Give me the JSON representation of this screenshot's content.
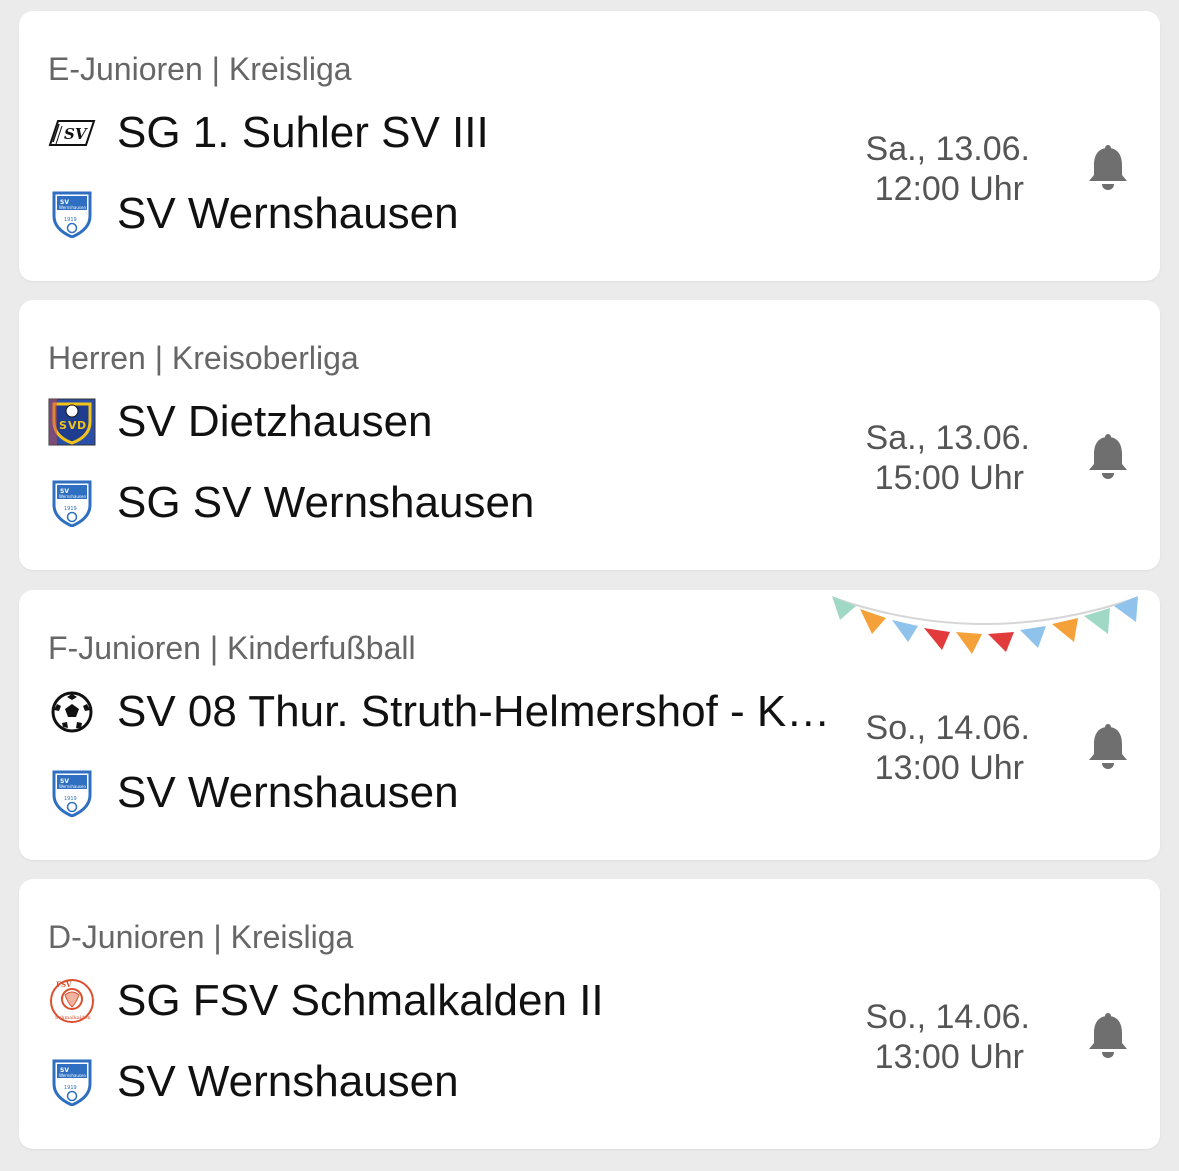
{
  "matches": [
    {
      "league": "E-Junioren | Kreisliga",
      "home": {
        "name": "SG 1. Suhler SV III",
        "crest": "suhl-sv-logo"
      },
      "away": {
        "name": "SV Wernshausen",
        "crest": "sv-wernshausen-crest"
      },
      "date": "Sa., 13.06.",
      "time": "12:00 Uhr",
      "bell_icon": "bell-icon"
    },
    {
      "league": "Herren | Kreisoberliga",
      "home": {
        "name": "SV Dietzhausen",
        "crest": "sv-dietzhausen-crest"
      },
      "away": {
        "name": "SG SV Wernshausen",
        "crest": "sv-wernshausen-crest"
      },
      "date": "Sa., 13.06.",
      "time": "15:00 Uhr",
      "bell_icon": "bell-icon"
    },
    {
      "league": "F-Junioren | Kinderfußball",
      "home": {
        "name": "SV 08 Thur. Struth-Helmershof - K…",
        "crest": "soccer-ball-icon"
      },
      "away": {
        "name": "SV Wernshausen",
        "crest": "sv-wernshausen-crest"
      },
      "date": "So., 14.06.",
      "time": "13:00 Uhr",
      "bell_icon": "bell-icon",
      "decoration": "bunting-garland"
    },
    {
      "league": "D-Junioren | Kreisliga",
      "home": {
        "name": "SG FSV Schmalkalden II",
        "crest": "fsv-schmalkalden-crest"
      },
      "away": {
        "name": "SV Wernshausen",
        "crest": "sv-wernshausen-crest"
      },
      "date": "So., 14.06.",
      "time": "13:00 Uhr",
      "bell_icon": "bell-icon"
    }
  ],
  "colors": {
    "background": "#ebebeb",
    "card": "#ffffff",
    "league_text": "#666666",
    "team_text": "#111111",
    "date_text": "#555555",
    "bell": "#6f6f6f"
  }
}
